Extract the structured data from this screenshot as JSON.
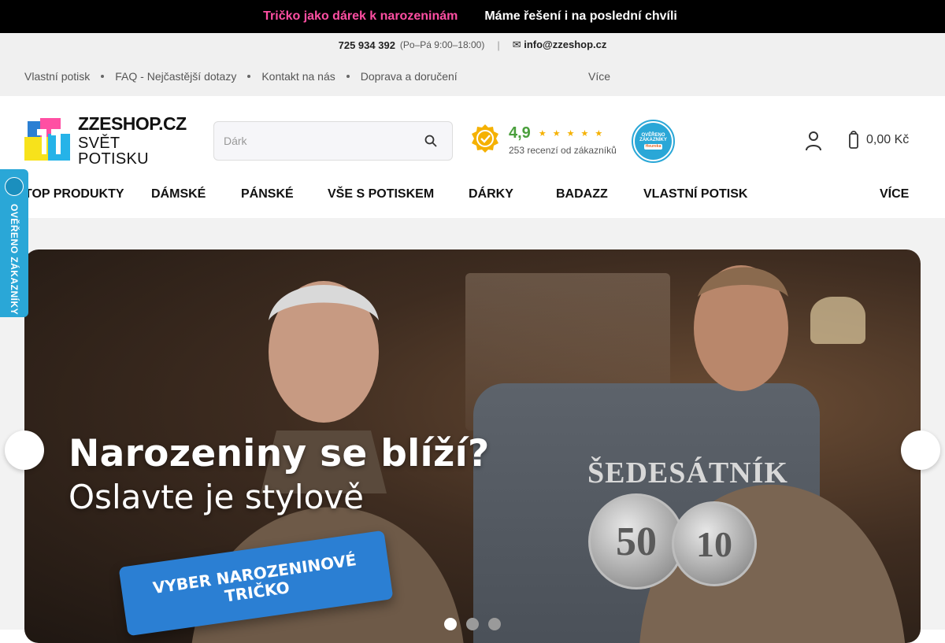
{
  "promo": {
    "left": "Tričko jako dárek k narozeninám",
    "right": "Máme řešení i na poslední chvíli",
    "arrow": "",
    "colors": {
      "pink": "#ff4fa3",
      "white": "#ffffff"
    }
  },
  "contact": {
    "phone": " 725 934 392",
    "hours": "(Po–Pá 9:00–18:00)",
    "separator": "|",
    "email": "✉ info@zzeshop.cz"
  },
  "info_nav": {
    "items": [
      {
        "label": "Vlastní potisk"
      },
      {
        "label": "FAQ - Nejčastější dotazy"
      },
      {
        "label": "Kontakt na nás"
      },
      {
        "label": "Doprava a doručení"
      }
    ],
    "more": "Více",
    "more_chevron": ""
  },
  "logo": {
    "line1": "ZZESHOP.CZ",
    "line2": "SVĚT POTISKU"
  },
  "search": {
    "placeholder": "Dárk",
    "icon": "search-icon"
  },
  "rating": {
    "score": "4,9",
    "stars": [
      "★",
      "★",
      "★",
      "★",
      "★"
    ],
    "count": "253 recenzí od zákazníků",
    "badge_color": "#f5b100"
  },
  "heureka": {
    "line1": "OVĚŘENO",
    "line2": "ZÁKAZNÍKY",
    "brand": "Heureka"
  },
  "cart": {
    "amount": "0,00 Kč",
    "chevron": ""
  },
  "main_nav": {
    "items": [
      {
        "label": "TOP PRODUKTY",
        "chevron": ""
      },
      {
        "label": "DÁMSKÉ",
        "chevron": ""
      },
      {
        "label": "PÁNSKÉ",
        "chevron": ""
      },
      {
        "label": "VŠE S POTISKEM",
        "chevron": ""
      },
      {
        "label": "DÁRKY ",
        "chevron": ""
      },
      {
        "label": "BADAZZ ",
        "chevron": ""
      },
      {
        "label": "VLASTNÍ POTISK",
        "chevron": ""
      },
      {
        "label": "VÍCE",
        "chevron": ""
      }
    ]
  },
  "side_badge": {
    "text": "OVĚŘENO ZÁKAZNÍKY"
  },
  "hero": {
    "title": "Narozeniny se blíží?",
    "subtitle": "Oslavte je stylově",
    "cta_line1": "VYBER NAROZENINOVÉ",
    "cta_line2": "TRIČKO",
    "shirt_title": "ŠEDESÁTNÍK",
    "coin1": "50",
    "coin2": "10",
    "prev": "",
    "next": ""
  },
  "slider": {
    "slides": 3,
    "active": 1
  }
}
